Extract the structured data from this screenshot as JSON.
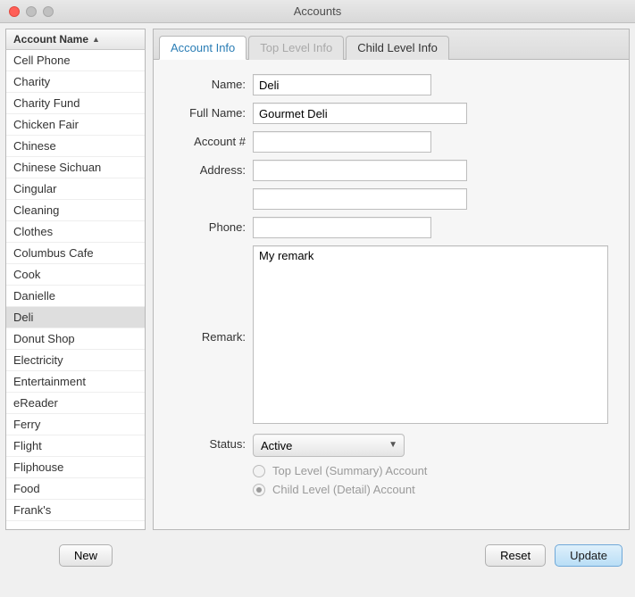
{
  "window": {
    "title": "Accounts"
  },
  "sidebar": {
    "header": "Account Name",
    "items": [
      "Cell Phone",
      "Charity",
      "Charity Fund",
      "Chicken Fair",
      "Chinese",
      "Chinese Sichuan",
      "Cingular",
      "Cleaning",
      "Clothes",
      "Columbus Cafe",
      "Cook",
      "Danielle",
      "Deli",
      "Donut Shop",
      "Electricity",
      "Entertainment",
      "eReader",
      "Ferry",
      "Flight",
      "Fliphouse",
      "Food",
      "Frank's"
    ],
    "selected_index": 12
  },
  "tabs": [
    {
      "label": "Account Info",
      "state": "active"
    },
    {
      "label": "Top Level Info",
      "state": "disabled"
    },
    {
      "label": "Child Level Info",
      "state": "normal"
    }
  ],
  "form": {
    "labels": {
      "name": "Name:",
      "full_name": "Full Name:",
      "account_num": "Account #",
      "address": "Address:",
      "phone": "Phone:",
      "remark": "Remark:",
      "status": "Status:"
    },
    "values": {
      "name": "Deli",
      "full_name": "Gourmet Deli",
      "account_num": "",
      "address1": "",
      "address2": "",
      "phone": "",
      "remark": "My remark",
      "status": "Active"
    },
    "radio": {
      "top": "Top Level (Summary) Account",
      "child": "Child Level (Detail) Account",
      "selected": "child"
    }
  },
  "buttons": {
    "new": "New",
    "reset": "Reset",
    "update": "Update"
  }
}
